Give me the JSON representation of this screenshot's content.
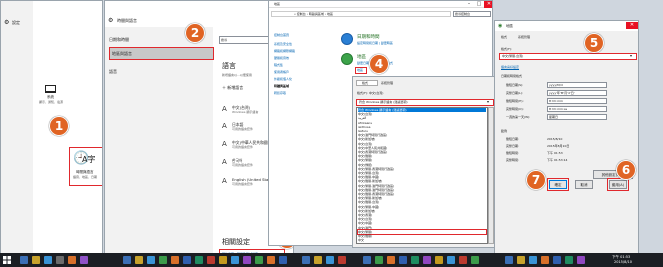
{
  "steps": [
    "1",
    "2",
    "3",
    "4",
    "5",
    "6",
    "7"
  ],
  "p1": {
    "title": "設定",
    "system_title": "系統",
    "system_desc": "顯示、通知、電源",
    "timelang_title": "時間與語言",
    "timelang_desc": "語音、地區、日期",
    "icons": {
      "home": "gear-icon",
      "system": "laptop-icon",
      "timelang": "time-language-icon"
    }
  },
  "p2": {
    "header": "時間與語言",
    "nav": [
      "日期和時間",
      "地區與語言",
      "語音"
    ],
    "search_placeholder": "搜尋",
    "section_title": "語言",
    "section_desc": "新增語言以...以便使用",
    "add_language": "新增語言",
    "languages": [
      {
        "t1": "中文(台灣)",
        "t2": "Windows 顯示語言"
      },
      {
        "t1": "日本語",
        "t2": "可用的語言套件"
      },
      {
        "t1": "中文(中華人民共和國)",
        "t2": "可用的語言套件"
      },
      {
        "t1": "한국어",
        "t2": "可用的語言套件"
      },
      {
        "t1": "English (United States)",
        "t2": "可用的語言套件"
      }
    ],
    "related_title": "相關設定",
    "related_link": "其他日期、時間及區域設定"
  },
  "p3": {
    "breadcrumb": "« 控制台 › 時鐘與區域 › 地區",
    "search_placeholder": "搜尋控制台",
    "side_links": [
      "控制台首頁",
      "系統及安全性",
      "網路和網際網路",
      "硬體和音效",
      "程式集",
      "使用者帳戶",
      "外觀和個人化",
      "時鐘與區域",
      "輕鬆存取"
    ],
    "item1_title": "日期和時間",
    "item1_links": "設定時間和日期 | 變更時區",
    "item2_title": "地區",
    "item2_links": "變更日期、時間或數字格式",
    "region_link": "地區"
  },
  "p4": {
    "tabs": [
      "格式",
      "系統管理"
    ],
    "format_label": "格式(F): 中文(台灣)",
    "selected": "符合 Windows 顯示語言 (建議選項)",
    "items": [
      "符合 Windows 顯示語言 (建議選項)",
      "中文(台灣)",
      "العربية",
      "Afrikaans",
      "isiXhosa",
      "IsiZulu",
      "中文(澳門特別行政區)",
      "中文(新加坡)",
      "中文(台灣)",
      "中文(中華人民共和國)",
      "中文(香港特別行政區)",
      "中文(簡體)",
      "中文(繁體)",
      "中文(傳統)",
      "中文(繁體,香港特別行政區)",
      "中文(繁體,台灣)",
      "中文(簡體,中國)",
      "中文(簡體,新加坡)",
      "中文(繁體,澳門特別行政區)",
      "中文(簡體,澳門特別行政區)",
      "中文(簡體,香港特別行政區)",
      "中文(繁體,新加坡)",
      "中文(簡體,台灣)",
      "中文(繁體,中國)",
      "中文(新加坡)",
      "中文(香港)",
      "中文(台灣)",
      "中文(中國)",
      "中文(澳門)",
      "中文(繁體)",
      "中文(簡體)",
      "中文"
    ],
    "highlight_index": 29
  },
  "p5": {
    "title": "地區",
    "tabs": [
      "格式",
      "系統管理"
    ],
    "format_label": "格式(F):",
    "format_value": "中文(繁體,台灣)",
    "lang_link": "語言喜好設定",
    "group_label": "日期和時間格式",
    "rows": [
      {
        "label": "簡短日期(S):",
        "value": "yyyy/M/d"
      },
      {
        "label": "完整日期(L):",
        "value": "yyyy'年'M'月'd'日'"
      },
      {
        "label": "簡短時間(H):",
        "value": "tt hh:mm"
      },
      {
        "label": "完整時間(O):",
        "value": "tt hh:mm:ss"
      },
      {
        "label": "一週的第一天(W):",
        "value": "星期日"
      }
    ],
    "examples_label": "範例",
    "examples": [
      {
        "label": "簡短日期:",
        "value": "2015/8/10"
      },
      {
        "label": "完整日期:",
        "value": "2015年8月10日"
      },
      {
        "label": "簡短時間:",
        "value": "下午 01:53"
      },
      {
        "label": "完整時間:",
        "value": "下午 01:53:14"
      }
    ],
    "other_settings": "其他設定(D)...",
    "ok": "確定",
    "cancel": "取消",
    "apply": "套用(A)"
  },
  "taskbar": {
    "time": "下午 01:53",
    "date": "2015/8/10"
  },
  "colors": {
    "accent": "#0078d7",
    "badge": "#e06424",
    "highlight": "#e0282d"
  }
}
